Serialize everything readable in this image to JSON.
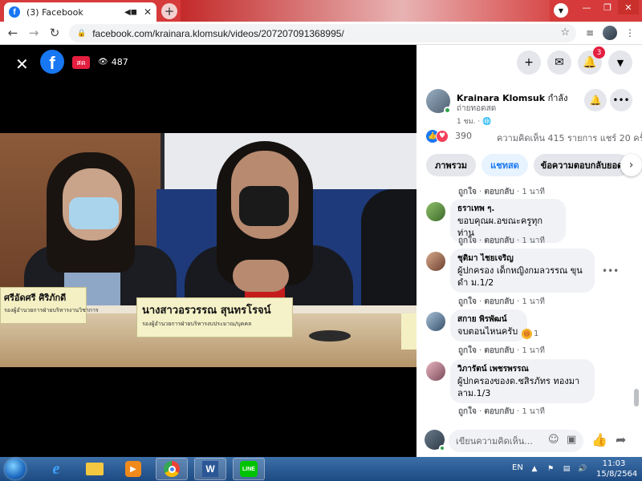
{
  "browser": {
    "tab_title": "(3) Facebook",
    "tab_audio_icon": "speaker-icon",
    "url": "facebook.com/krainara.klomsuk/videos/207207091368995/"
  },
  "video": {
    "live_label": "สด",
    "viewer_count": "487",
    "nameplate_left_name": "ศรีอัดศรี ศิริภักดี",
    "nameplate_left_sub": "รองผู้อำนวยการฝ่ายบริหารงานวิชาการ",
    "nameplate_main_name": "นางสาวอรวรรณ สุนทรโรจน์",
    "nameplate_main_sub": "รองผู้อำนวยการฝ่ายบริหารงบประมาณ/บุคคล"
  },
  "header_icons": {
    "notifications_count": "3"
  },
  "post": {
    "author": "Krainara Klomsuk",
    "status_suffix": "กำลัง",
    "status_line2": "ถ่ายทอดสด",
    "time": "1 ชม. · ",
    "reaction_count": "390",
    "comments_shares": "ความคิดเห็น 415 รายการ  แชร์ 20 ครั้ง"
  },
  "tabs": [
    {
      "label": "ภาพรวม"
    },
    {
      "label": "แชทสด"
    },
    {
      "label": "ข้อความตอบกลับยอด"
    }
  ],
  "comment_actions": {
    "like": "ถูกใจ",
    "reply": "ตอบกลับ",
    "time": "1 นาที"
  },
  "comments": [
    {
      "name": "ธราเทพ ๆ.",
      "text": "ขอบคุณผ.อขณะครูทุกท่าน"
    },
    {
      "name": "ชุติมา ไชยเจริญ",
      "text": "ผู้ปกครอง เด็กหญิงกมลวรรณ ขุนดำ ม.1/2"
    },
    {
      "name": "สกาย พิรพัฒน์",
      "text": "จบตอนไหนครับ",
      "reaction_count": "1"
    },
    {
      "name": "วิภารัตน์ เพชรพรรณ",
      "text": "ผู้ปกครองของด.ชสิรภัทร ทองมาลาม.1/3"
    }
  ],
  "composer": {
    "placeholder": "เขียนความคิดเห็น..."
  },
  "taskbar": {
    "lang": "EN",
    "time": "11:03",
    "date": "15/8/2564"
  }
}
